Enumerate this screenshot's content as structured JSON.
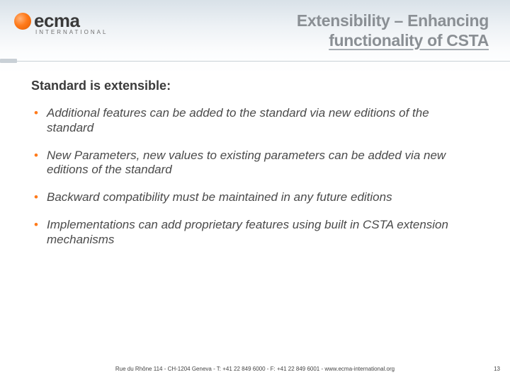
{
  "logo": {
    "name": "ecma",
    "sub": "INTERNATIONAL"
  },
  "title": {
    "line1": "Extensibility – Enhancing",
    "line2": "functionality of CSTA"
  },
  "heading": "Standard is extensible:",
  "bullets": [
    "Additional features can be added to the standard via new editions of the standard",
    "New Parameters, new values to existing parameters can be added via new editions of the standard",
    "Backward compatibility must be maintained in any future editions",
    "Implementations can add proprietary features using built in CSTA extension mechanisms"
  ],
  "footer": "Rue du Rhône 114 - CH-1204 Geneva - T: +41 22 849 6000 - F: +41 22 849 6001 - www.ecma-international.org",
  "pagenum": "13"
}
